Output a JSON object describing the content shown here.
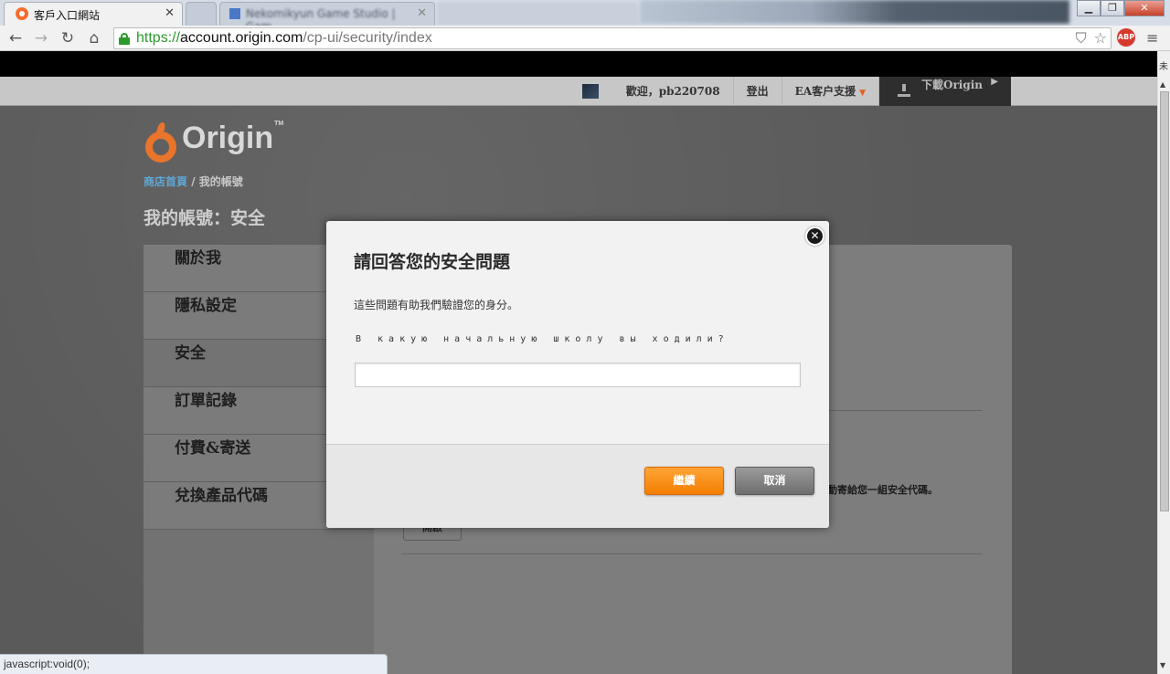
{
  "browser": {
    "active_tab_title": "客戶入口網站",
    "bg_tab_title": "Nekomikyun Game Studio | Gam...",
    "url_scheme": "https://",
    "url_host": "account.origin.com",
    "url_path": "/cp-ui/security/index",
    "status_text": "javascript:void(0);",
    "abp_label": "ABP",
    "scrollbar_char": "未"
  },
  "topnav": {
    "welcome": "歡迎，pb220708",
    "logout": "登出",
    "support": "EA客户支援",
    "download": "下載Origin"
  },
  "header": {
    "logo_text": "Origin",
    "logo_tm": "TM",
    "breadcrumb_home": "商店首頁",
    "breadcrumb_sep": "/",
    "breadcrumb_current": "我的帳號",
    "page_title": "我的帳號：安全"
  },
  "sidebar": {
    "items": [
      {
        "label": "關於我"
      },
      {
        "label": "隱私設定"
      },
      {
        "label": "安全"
      },
      {
        "label": "訂單記錄"
      },
      {
        "label": "付費&寄送"
      },
      {
        "label": "兌換產品代碼"
      }
    ]
  },
  "main": {
    "bg_text_fragment": "動寄給您一組安全代碼。",
    "bg_button_fragment": "開啟"
  },
  "modal": {
    "title": "請回答您的安全問題",
    "description": "這些問題有助我們驗證您的身分。",
    "question": "В какую начальную школу вы ходили?",
    "answer_value": "",
    "continue_label": "繼續",
    "cancel_label": "取消"
  }
}
